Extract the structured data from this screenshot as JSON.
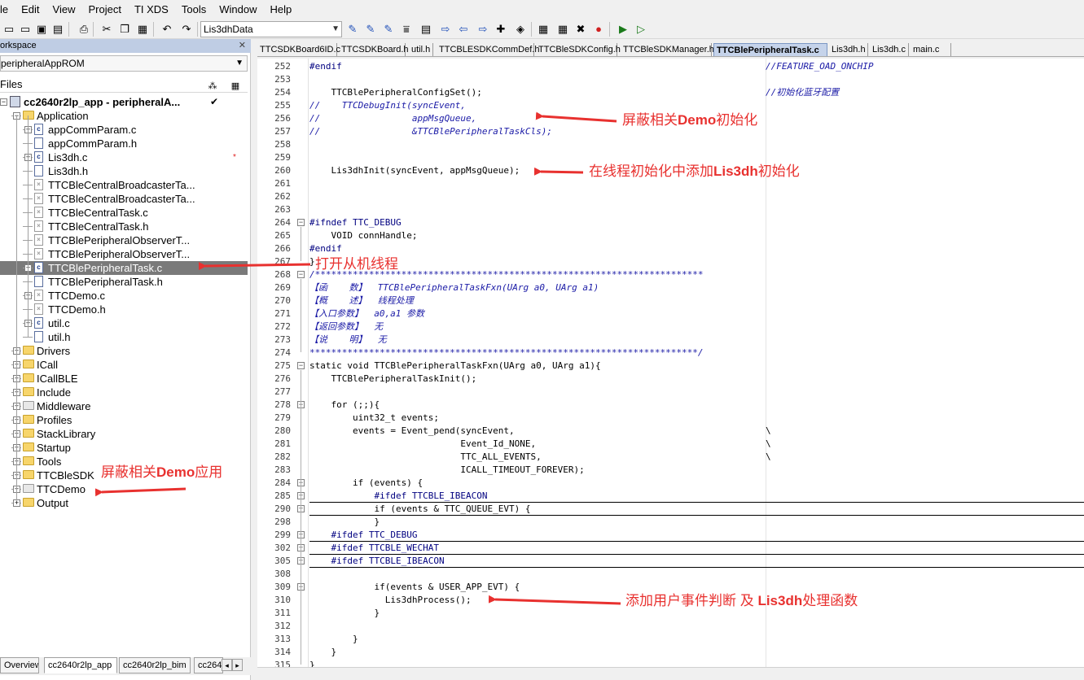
{
  "menu": [
    "le",
    "Edit",
    "View",
    "Project",
    "TI XDS",
    "Tools",
    "Window",
    "Help"
  ],
  "toolbar": {
    "search_value": "Lis3dhData",
    "icons": [
      "new-file-icon",
      "open-icon",
      "save-icon",
      "save-all-icon",
      "print-icon",
      "cut-icon",
      "copy-icon",
      "paste-icon",
      "undo-icon",
      "redo-icon",
      "find-icon",
      "find-next-icon",
      "find-prev-icon",
      "find-in-files-icon",
      "goto-icon",
      "navigate-back-icon",
      "navigate-forward-icon",
      "bookmark-icon",
      "compile-icon",
      "make-icon",
      "stop-build-icon",
      "breakpoint-icon",
      "download-debug-icon",
      "debug-no-download-icon"
    ]
  },
  "workspace": {
    "title": "orkspace",
    "config": "peripheralAppROM",
    "files_label": "Files",
    "tree": [
      {
        "label": "cc2640r2lp_app - peripheralA...",
        "type": "project",
        "level": 0,
        "bold": true,
        "check": "✔"
      },
      {
        "label": "Application",
        "type": "folder",
        "level": 1,
        "expander": "−"
      },
      {
        "label": "appCommParam.c",
        "type": "cfile",
        "level": 2,
        "expander": "+"
      },
      {
        "label": "appCommParam.h",
        "type": "hfile",
        "level": 2
      },
      {
        "label": "Lis3dh.c",
        "type": "cfile",
        "level": 2,
        "expander": "+",
        "star": "*"
      },
      {
        "label": "Lis3dh.h",
        "type": "hfile",
        "level": 2
      },
      {
        "label": "TTCBleCentralBroadcasterTa...",
        "type": "xfile",
        "level": 2
      },
      {
        "label": "TTCBleCentralBroadcasterTa...",
        "type": "xfile",
        "level": 2
      },
      {
        "label": "TTCBleCentralTask.c",
        "type": "xfile",
        "level": 2
      },
      {
        "label": "TTCBleCentralTask.h",
        "type": "xfile",
        "level": 2
      },
      {
        "label": "TTCBlePeripheralObserverT...",
        "type": "xfile",
        "level": 2
      },
      {
        "label": "TTCBlePeripheralObserverT...",
        "type": "xfile",
        "level": 2
      },
      {
        "label": "TTCBlePeripheralTask.c",
        "type": "cfile",
        "level": 2,
        "expander": "+",
        "selected": true
      },
      {
        "label": "TTCBlePeripheralTask.h",
        "type": "hfile",
        "level": 2
      },
      {
        "label": "TTCDemo.c",
        "type": "xfile",
        "level": 2,
        "expander": "+"
      },
      {
        "label": "TTCDemo.h",
        "type": "xfile",
        "level": 2
      },
      {
        "label": "util.c",
        "type": "cfile",
        "level": 2,
        "expander": "+"
      },
      {
        "label": "util.h",
        "type": "hfile",
        "level": 2
      },
      {
        "label": "Drivers",
        "type": "folder",
        "level": 1,
        "expander": "+"
      },
      {
        "label": "ICall",
        "type": "folder",
        "level": 1,
        "expander": "+"
      },
      {
        "label": "ICallBLE",
        "type": "folder",
        "level": 1,
        "expander": "+"
      },
      {
        "label": "Include",
        "type": "folder",
        "level": 1,
        "expander": "+"
      },
      {
        "label": "Middleware",
        "type": "graydfolder",
        "level": 1,
        "expander": "+"
      },
      {
        "label": "Profiles",
        "type": "folder",
        "level": 1,
        "expander": "+"
      },
      {
        "label": "StackLibrary",
        "type": "folder",
        "level": 1,
        "expander": "+"
      },
      {
        "label": "Startup",
        "type": "folder",
        "level": 1,
        "expander": "+"
      },
      {
        "label": "Tools",
        "type": "folder",
        "level": 1,
        "expander": "+"
      },
      {
        "label": "TTCBleSDK",
        "type": "folder",
        "level": 1,
        "expander": "+"
      },
      {
        "label": "TTCDemo",
        "type": "graydfolder",
        "level": 1,
        "expander": "+"
      },
      {
        "label": "Output",
        "type": "folder",
        "level": 1,
        "expander": "+"
      }
    ],
    "bottom_tabs": [
      "Overview",
      "cc2640r2lp_app",
      "cc2640r2lp_bim",
      "cc264"
    ]
  },
  "editor": {
    "tabs": [
      "TTCSDKBoard6ID.c",
      "TTCSDKBoard.h",
      "util.h",
      "TTCBLESDKCommDef.h",
      "TTCBleSDKConfig.h",
      "TTCBleSDKManager.h",
      "TTCBlePeripheralTask.c",
      "Lis3dh.h",
      "Lis3dh.c",
      "main.c"
    ],
    "active_tab": "TTCBlePeripheralTask.c",
    "lines": [
      {
        "n": "252",
        "code": "#endif",
        "rc": "//FEATURE_OAD_ONCHIP",
        "style": "pp"
      },
      {
        "n": "253",
        "code": ""
      },
      {
        "n": "254",
        "code": "    TTCBlePeripheralConfigSet();",
        "rc": "//初始化蓝牙配置"
      },
      {
        "n": "255",
        "code": "//    TTCDebugInit(syncEvent,",
        "style": "cm"
      },
      {
        "n": "256",
        "code": "//                 appMsgQueue,",
        "style": "cm"
      },
      {
        "n": "257",
        "code": "//                 &TTCBlePeripheralTaskCls);",
        "style": "cm"
      },
      {
        "n": "258",
        "code": ""
      },
      {
        "n": "259",
        "code": ""
      },
      {
        "n": "260",
        "code": "    Lis3dhInit(syncEvent, appMsgQueue);"
      },
      {
        "n": "261",
        "code": ""
      },
      {
        "n": "262",
        "code": ""
      },
      {
        "n": "263",
        "code": ""
      },
      {
        "n": "264",
        "code": "#ifndef TTC_DEBUG",
        "style": "pp",
        "fold": "−"
      },
      {
        "n": "265",
        "code": "    VOID connHandle;"
      },
      {
        "n": "266",
        "code": "#endif",
        "style": "pp"
      },
      {
        "n": "267",
        "code": "}"
      },
      {
        "n": "268",
        "code": "/************************************************************************",
        "style": "cm",
        "fold": "−"
      },
      {
        "n": "269",
        "code": "【函    数】  TTCBlePeripheralTaskFxn(UArg a0, UArg a1)",
        "style": "cm"
      },
      {
        "n": "270",
        "code": "【概    述】  线程处理",
        "style": "cm"
      },
      {
        "n": "271",
        "code": "【入口参数】  a0,a1 参数",
        "style": "cm"
      },
      {
        "n": "272",
        "code": "【返回参数】  无",
        "style": "cm"
      },
      {
        "n": "273",
        "code": "【说    明】  无",
        "style": "cm"
      },
      {
        "n": "274",
        "code": "************************************************************************/",
        "style": "cm"
      },
      {
        "n": "275",
        "code": "static void TTCBlePeripheralTaskFxn(UArg a0, UArg a1){",
        "fold": "−"
      },
      {
        "n": "276",
        "code": "    TTCBlePeripheralTaskInit();"
      },
      {
        "n": "277",
        "code": ""
      },
      {
        "n": "278",
        "code": "    for (;;){",
        "fold": "−"
      },
      {
        "n": "279",
        "code": "        uint32_t events;"
      },
      {
        "n": "280",
        "code": "        events = Event_pend(syncEvent,",
        "bs": "\\"
      },
      {
        "n": "281",
        "code": "                            Event_Id_NONE,",
        "bs": "\\"
      },
      {
        "n": "282",
        "code": "                            TTC_ALL_EVENTS,",
        "bs": "\\"
      },
      {
        "n": "283",
        "code": "                            ICALL_TIMEOUT_FOREVER);"
      },
      {
        "n": "284",
        "code": "        if (events) {",
        "fold": "−"
      },
      {
        "n": "285",
        "code": "            #ifdef TTCBLE_IBEACON",
        "style": "pp",
        "fold": "+",
        "underline": true
      },
      {
        "n": "290",
        "code": "            if (events & TTC_QUEUE_EVT) {",
        "fold": "+",
        "underline": true
      },
      {
        "n": "298",
        "code": "            }"
      },
      {
        "n": "299",
        "code": "    #ifdef TTC_DEBUG",
        "style": "pp",
        "fold": "+",
        "underline": true
      },
      {
        "n": "302",
        "code": "    #ifdef TTCBLE_WECHAT",
        "style": "pp",
        "fold": "+",
        "underline": true
      },
      {
        "n": "305",
        "code": "    #ifdef TTCBLE_IBEACON",
        "style": "pp",
        "fold": "+",
        "underline": true
      },
      {
        "n": "308",
        "code": ""
      },
      {
        "n": "309",
        "code": "            if(events & USER_APP_EVT) {",
        "fold": "−"
      },
      {
        "n": "310",
        "code": "              Lis3dhProcess();"
      },
      {
        "n": "311",
        "code": "            }"
      },
      {
        "n": "312",
        "code": ""
      },
      {
        "n": "313",
        "code": "        }"
      },
      {
        "n": "314",
        "code": "    }"
      },
      {
        "n": "315",
        "code": "}"
      }
    ]
  },
  "annotations": {
    "mask_demo_init_prefix": "屏蔽相关",
    "mask_demo_init_bold": "Demo",
    "mask_demo_init_suffix": "初始化",
    "add_lis3dh_init_prefix": "在线程初始化中添加",
    "add_lis3dh_init_bold": "Lis3dh",
    "add_lis3dh_init_suffix": "初始化",
    "open_slave_thread": "打开从机线程",
    "mask_demo_app_prefix": "屏蔽相关",
    "mask_demo_app_bold": "Demo",
    "mask_demo_app_suffix": "应用",
    "add_user_event_prefix": "添加用户事件判断 及 ",
    "add_user_event_bold": "Lis3dh",
    "add_user_event_suffix": "处理函数",
    "color": "#e8312f"
  }
}
